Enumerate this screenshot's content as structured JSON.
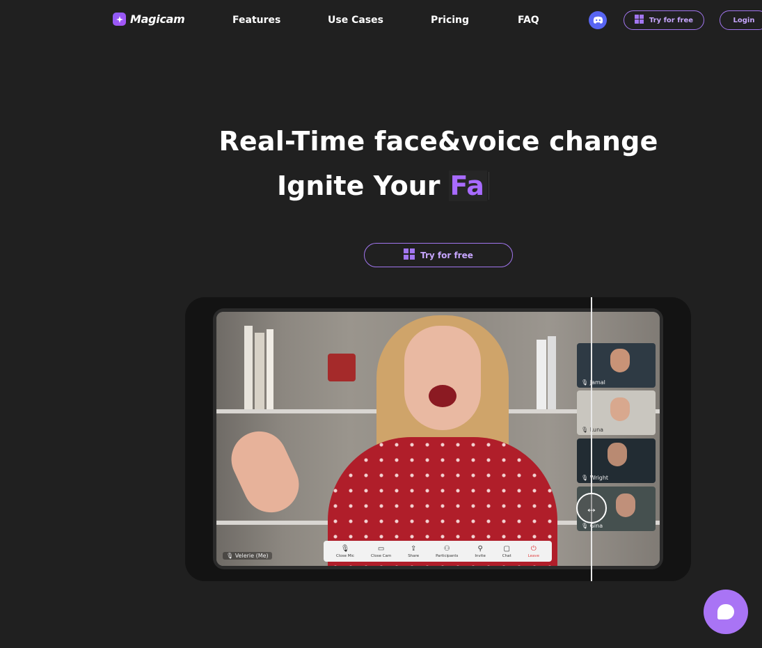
{
  "brand": {
    "name": "Magicam",
    "accent": "#a86bff"
  },
  "nav": {
    "links": [
      "Features",
      "Use Cases",
      "Pricing",
      "FAQ"
    ],
    "try_label": "Try for free",
    "login_label": "Login",
    "discord_icon": "discord-icon"
  },
  "hero": {
    "headline": "Real-Time face&voice change",
    "subline_prefix": "Ignite Your",
    "subline_typed": "Fa",
    "cta_label": "Try for free"
  },
  "demo": {
    "self_label": "Velerie (Me)",
    "participants": [
      "Jamal",
      "Luna",
      "Wright",
      "Gina"
    ],
    "toolbar": [
      {
        "label": "Close Mic",
        "icon": "mic-icon"
      },
      {
        "label": "Close Cam",
        "icon": "camera-icon"
      },
      {
        "label": "Share",
        "icon": "share-icon"
      },
      {
        "label": "Participants",
        "icon": "participants-icon"
      },
      {
        "label": "Invite",
        "icon": "invite-icon"
      },
      {
        "label": "Chat",
        "icon": "chat-icon"
      },
      {
        "label": "Leave",
        "icon": "power-icon"
      }
    ]
  }
}
